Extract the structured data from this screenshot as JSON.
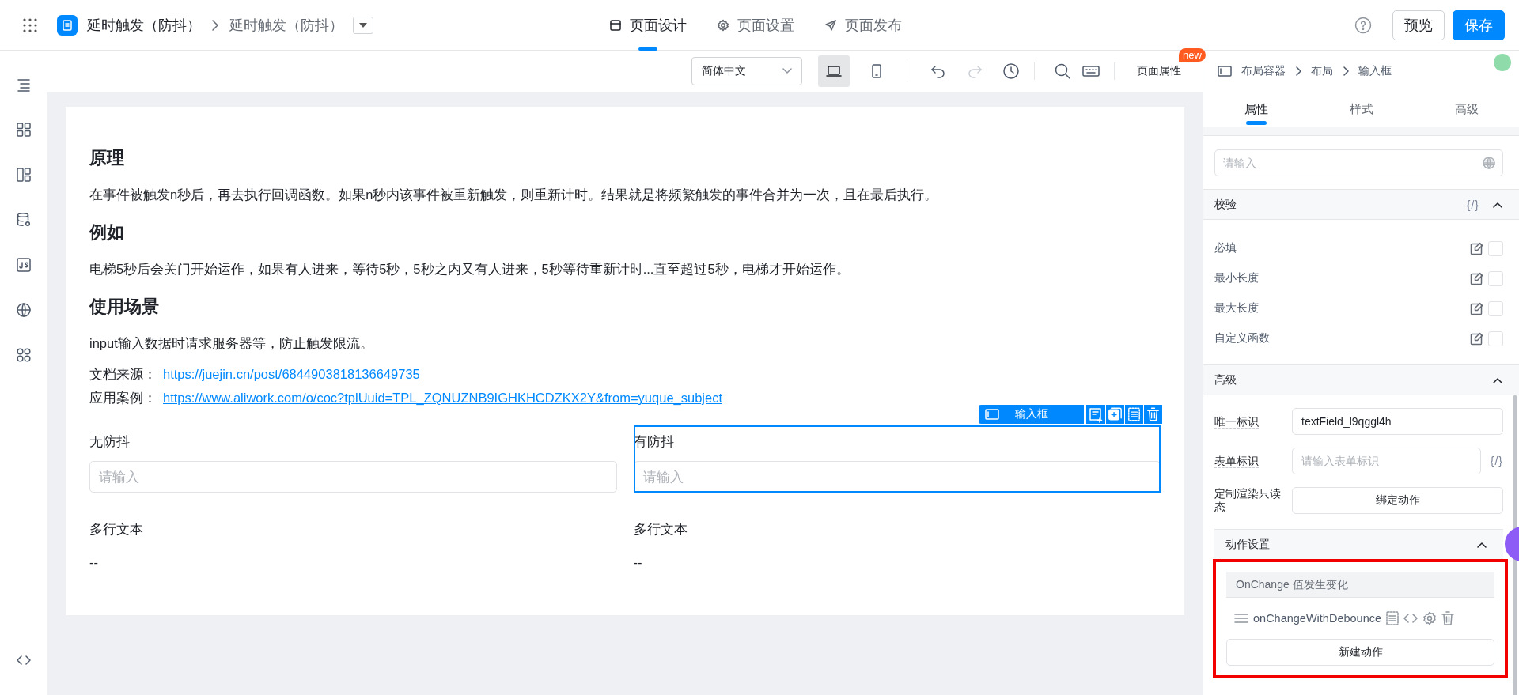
{
  "header": {
    "title": "延时触发（防抖）",
    "page_name": "延时触发（防抖）",
    "preview_button": "预览",
    "save_button": "保存"
  },
  "mode_tabs": [
    {
      "label": "页面设计",
      "kind": "design",
      "selected": true
    },
    {
      "label": "页面设置",
      "kind": "settings",
      "selected": false
    },
    {
      "label": "页面发布",
      "kind": "publish",
      "selected": false
    }
  ],
  "toolbar": {
    "language": "简体中文",
    "devices": [
      {
        "kind": "desktop",
        "selected": true
      },
      {
        "kind": "mobile",
        "selected": false
      }
    ],
    "page_properties": "页面属性",
    "badge": "new"
  },
  "canvas": {
    "blocks": [
      {
        "kind": "heading",
        "text": "原理"
      },
      {
        "kind": "paragraph",
        "text": "在事件被触发n秒后，再去执行回调函数。如果n秒内该事件被重新触发，则重新计时。结果就是将频繁触发的事件合并为一次，且在最后执行。"
      },
      {
        "kind": "heading",
        "text": "例如"
      },
      {
        "kind": "paragraph",
        "text": "电梯5秒后会关门开始运作，如果有人进来，等待5秒，5秒之内又有人进来，5秒等待重新计时...直至超过5秒，电梯才开始运作。"
      },
      {
        "kind": "heading",
        "text": "使用场景"
      },
      {
        "kind": "paragraph",
        "text": "input输入数据时请求服务器等，防止触发限流。"
      },
      {
        "kind": "link",
        "label": "文档来源：",
        "url": "https://juejin.cn/post/6844903818136649735"
      },
      {
        "kind": "link",
        "label": "应用案例：",
        "url": "https://www.aliwork.com/o/coc?tplUuid=TPL_ZQNUZNB9IGHKHCDZKX2Y&from=yuque_subject"
      }
    ],
    "selection_tag": "输入框",
    "fields": [
      {
        "kind": "input",
        "label": "无防抖",
        "placeholder": "请输入",
        "selected": false
      },
      {
        "kind": "input",
        "label": "有防抖",
        "placeholder": "请输入",
        "selected": true
      },
      {
        "kind": "text",
        "label": "多行文本",
        "value": "--",
        "selected": false
      },
      {
        "kind": "text",
        "label": "多行文本",
        "value": "--",
        "selected": false
      }
    ]
  },
  "panel": {
    "breadcrumb": [
      "布局容器",
      "布局",
      "输入框"
    ],
    "tabs": [
      {
        "label": "属性",
        "selected": true
      },
      {
        "label": "样式",
        "selected": false
      },
      {
        "label": "高级",
        "selected": false
      }
    ],
    "placeholder": "请输入",
    "validation": {
      "title": "校验",
      "code_toggle": "{/}",
      "expanded": true,
      "rules": [
        {
          "label": "必填",
          "checked": false
        },
        {
          "label": "最小长度",
          "checked": false
        },
        {
          "label": "最大长度",
          "checked": false
        },
        {
          "label": "自定义函数",
          "checked": false
        }
      ]
    },
    "advanced": {
      "title": "高级",
      "expanded": true,
      "unique_id": {
        "label": "唯一标识",
        "value": "textField_l9qggl4h"
      },
      "form_id": {
        "label": "表单标识",
        "placeholder": "请输入表单标识",
        "code_toggle": "{/}"
      },
      "readonly_render": {
        "label": "定制渲染只读态",
        "button": "绑定动作"
      }
    },
    "actions": {
      "title": "动作设置",
      "expanded": true,
      "highlighted": true,
      "event": "OnChange 值发生变化",
      "handlers": [
        "onChangeWithDebounce"
      ],
      "new_button": "新建动作"
    }
  }
}
